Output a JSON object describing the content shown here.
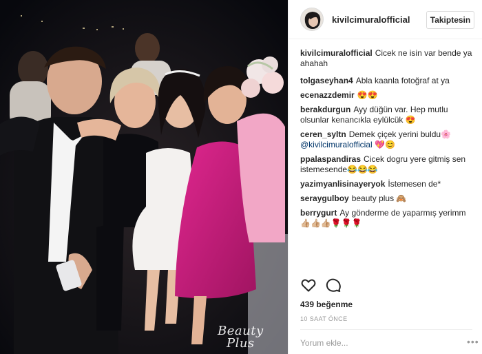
{
  "post": {
    "username": "kivilcimuralofficial",
    "follow_label": "Takiptesin",
    "caption": {
      "user": "kivilcimuralofficial",
      "text": "Cicek ne isin var bende ya ahahah"
    },
    "comments": [
      {
        "user": "tolgaseyhan4",
        "text": "Abla kaanla fotoğraf at ya"
      },
      {
        "user": "ecenazzdemir",
        "text": "😍😍"
      },
      {
        "user": "berakdurgun",
        "text": "Ayy düğün var. Hep mutlu olsunlar kenancıkla eylülcük 😍"
      },
      {
        "user": "ceren_syltn",
        "text": "Demek çiçek yerini buldu🌸",
        "mention": "@kivilcimuralofficial",
        "after": "💖😊"
      },
      {
        "user": "ppalaspandiras",
        "text": "Cicek dogru yere gitmiş sen istemesende😂😂😂"
      },
      {
        "user": "yazimyanlisinayeryok",
        "text": "İstemesen de*"
      },
      {
        "user": "seraygulboy",
        "text": "beauty plus 🙈"
      },
      {
        "user": "berrygurt",
        "text": "Ay gönderme de yaparmış yerimm 👍🏼👍🏼👍🏼🌹🌹🌹"
      }
    ],
    "likes": "439 beğenme",
    "timestamp": "10 SAAT ÖNCE",
    "comment_placeholder": "Yorum ekle...",
    "more_label": "•••",
    "watermark_line1": "Beauty",
    "watermark_line2": "Plus"
  },
  "icons": {
    "like": "heart-outline-icon",
    "comment": "speech-bubble-icon",
    "more": "ellipsis-icon"
  },
  "colors": {
    "text": "#262626",
    "muted": "#999999",
    "border": "#efefef",
    "mention": "#003569"
  }
}
